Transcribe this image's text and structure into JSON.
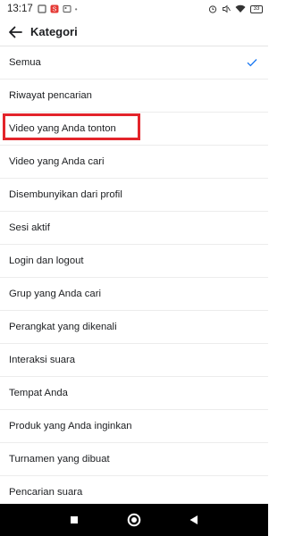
{
  "status_bar": {
    "time": "13:17",
    "battery_level": "33"
  },
  "header": {
    "title": "Kategori"
  },
  "list": {
    "items": [
      {
        "label": "Semua",
        "selected": true
      },
      {
        "label": "Riwayat pencarian",
        "selected": false
      },
      {
        "label": "Video yang Anda tonton",
        "selected": false,
        "highlighted": true
      },
      {
        "label": "Video yang Anda cari",
        "selected": false
      },
      {
        "label": "Disembunyikan dari profil",
        "selected": false
      },
      {
        "label": "Sesi aktif",
        "selected": false
      },
      {
        "label": "Login dan logout",
        "selected": false
      },
      {
        "label": "Grup yang Anda cari",
        "selected": false
      },
      {
        "label": "Perangkat yang dikenali",
        "selected": false
      },
      {
        "label": "Interaksi suara",
        "selected": false
      },
      {
        "label": "Tempat Anda",
        "selected": false
      },
      {
        "label": "Produk yang Anda inginkan",
        "selected": false
      },
      {
        "label": "Turnamen yang dibuat",
        "selected": false
      },
      {
        "label": "Pencarian suara",
        "selected": false
      }
    ]
  },
  "colors": {
    "accent": "#1877f2",
    "highlight_box": "#e3242b",
    "nav_bar": "#000000"
  }
}
